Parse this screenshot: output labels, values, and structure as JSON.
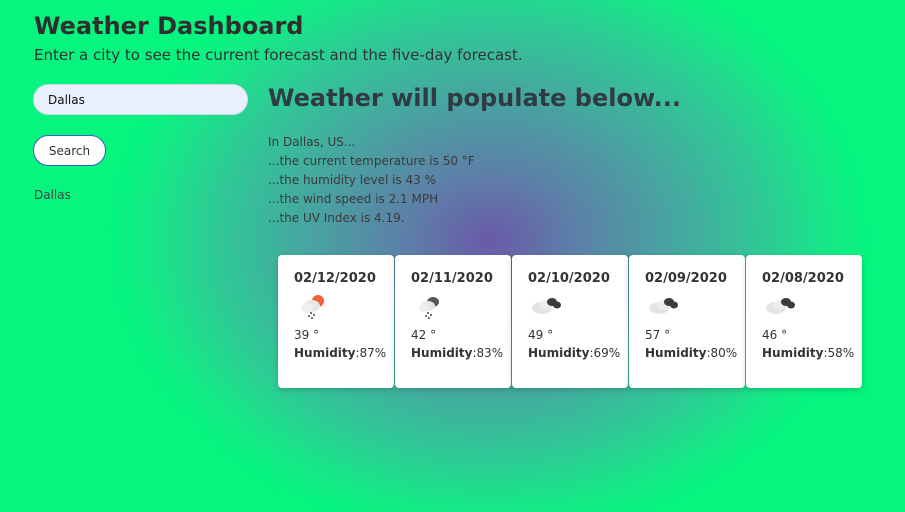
{
  "header": {
    "title": "Weather Dashboard",
    "subtitle": "Enter a city to see the current forecast and the five-day forecast."
  },
  "search": {
    "value": "Dallas",
    "button_label": "Search"
  },
  "history": [
    "Dallas"
  ],
  "main": {
    "heading": "Weather will populate below...",
    "current": {
      "location_line": "In Dallas, US...",
      "temp_line": "...the current temperature is 50 °F",
      "humidity_line": "...the humidity level is 43 %",
      "wind_line": "...the wind speed is 2.1 MPH",
      "uv_line": "...the UV Index is 4.19."
    }
  },
  "forecast": [
    {
      "date": "02/12/2020",
      "icon": "rain-sun-icon",
      "temp": "39 °",
      "humidity_label": "Humidity",
      "humidity_value": ":87%"
    },
    {
      "date": "02/11/2020",
      "icon": "rain-cloud-icon",
      "temp": "42 °",
      "humidity_label": "Humidity",
      "humidity_value": ":83%"
    },
    {
      "date": "02/10/2020",
      "icon": "broken-clouds-icon",
      "temp": "49 °",
      "humidity_label": "Humidity",
      "humidity_value": ":69%"
    },
    {
      "date": "02/09/2020",
      "icon": "broken-clouds-icon",
      "temp": "57 °",
      "humidity_label": "Humidity",
      "humidity_value": ":80%"
    },
    {
      "date": "02/08/2020",
      "icon": "broken-clouds-icon",
      "temp": "46 °",
      "humidity_label": "Humidity",
      "humidity_value": ":58%"
    }
  ]
}
